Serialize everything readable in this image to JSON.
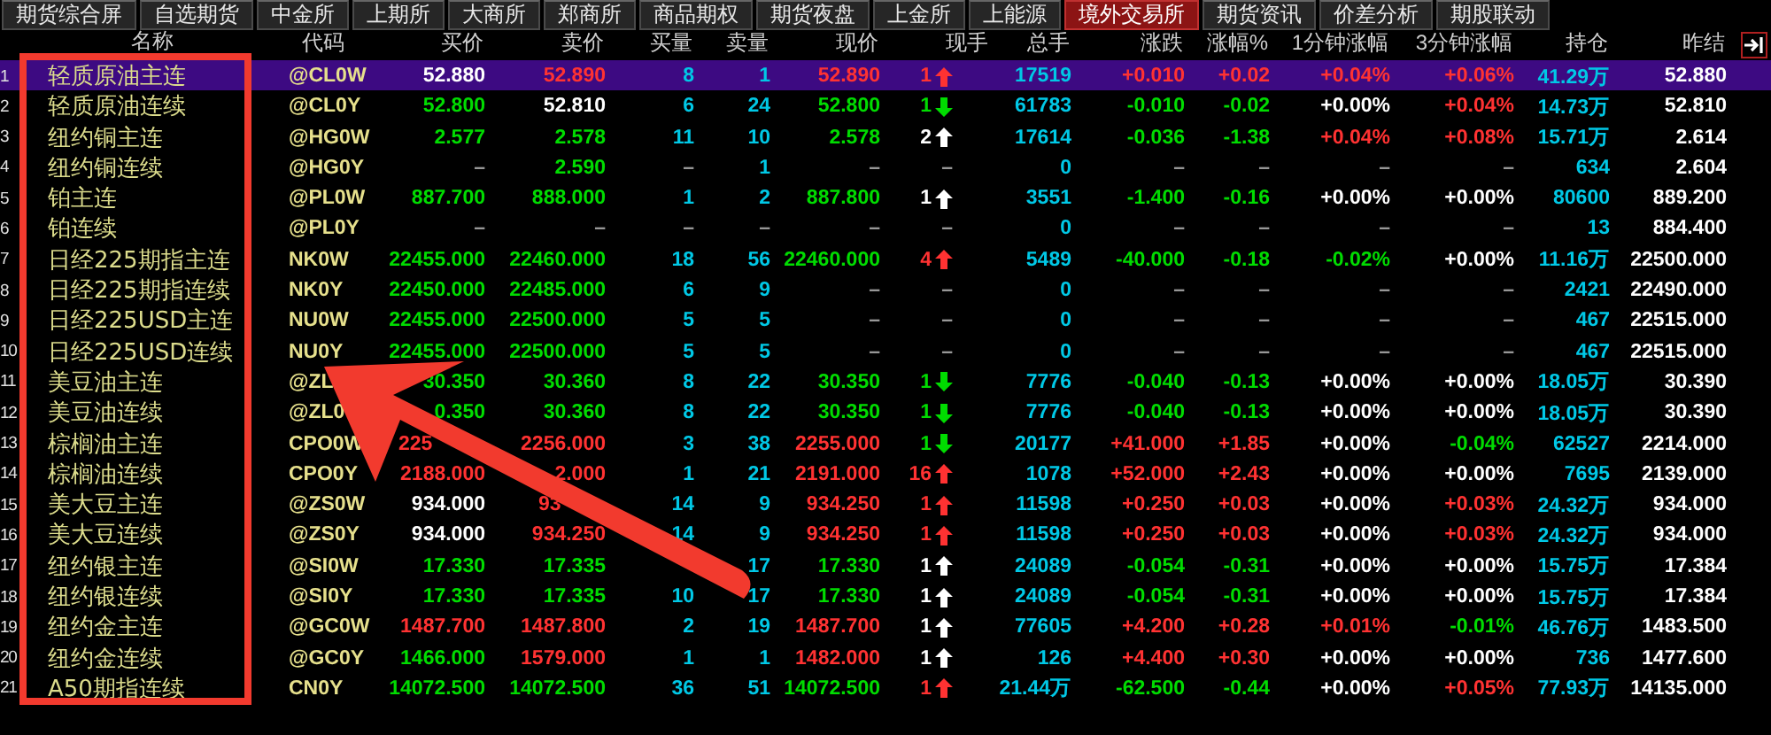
{
  "tabs": [
    {
      "label": "期货综合屏",
      "selected": false
    },
    {
      "label": "自选期货",
      "selected": false
    },
    {
      "label": "中金所",
      "selected": false
    },
    {
      "label": "上期所",
      "selected": false
    },
    {
      "label": "大商所",
      "selected": false
    },
    {
      "label": "郑商所",
      "selected": false
    },
    {
      "label": "商品期权",
      "selected": false
    },
    {
      "label": "期货夜盘",
      "selected": false
    },
    {
      "label": "上金所",
      "selected": false
    },
    {
      "label": "上能源",
      "selected": false
    },
    {
      "label": "境外交易所",
      "selected": true
    },
    {
      "label": "期货资讯",
      "selected": false
    },
    {
      "label": "价差分析",
      "selected": false
    },
    {
      "label": "期股联动",
      "selected": false
    }
  ],
  "columns": [
    "名称",
    "代码",
    "买价",
    "卖价",
    "买量",
    "卖量",
    "现价",
    "现手",
    "总手",
    "涨跌",
    "涨幅%",
    "1分钟涨幅",
    "3分钟涨幅",
    "持仓",
    "昨结"
  ],
  "rows": [
    {
      "no": "1",
      "name": "轻质原油主连",
      "code": "@CL0W",
      "selected": true,
      "cells": [
        {
          "text": "52.880",
          "kind": "even"
        },
        {
          "text": "52.890",
          "kind": "rise"
        },
        {
          "text": "8",
          "kind": "vol"
        },
        {
          "text": "1",
          "kind": "vol"
        },
        {
          "text": "52.890",
          "kind": "rise"
        },
        {
          "text": "1",
          "kind": "rise"
        },
        {
          "text": "17519",
          "kind": "vol"
        },
        {
          "text": "+0.010",
          "kind": "rise"
        },
        {
          "text": "+0.02",
          "kind": "rise"
        },
        {
          "text": "+0.04%",
          "kind": "rise"
        },
        {
          "text": "+0.06%",
          "kind": "rise"
        },
        {
          "text": "41.29万",
          "kind": "vol"
        },
        {
          "text": "52.880",
          "kind": "even"
        }
      ]
    },
    {
      "no": "2",
      "name": "轻质原油连续",
      "code": "@CL0Y",
      "selected": false,
      "cells": [
        {
          "text": "52.800",
          "kind": "fall"
        },
        {
          "text": "52.810",
          "kind": "even"
        },
        {
          "text": "6",
          "kind": "vol"
        },
        {
          "text": "24",
          "kind": "vol"
        },
        {
          "text": "52.800",
          "kind": "fall"
        },
        {
          "text": "1",
          "kind": "fall"
        },
        {
          "text": "61783",
          "kind": "vol"
        },
        {
          "text": "-0.010",
          "kind": "fall"
        },
        {
          "text": "-0.02",
          "kind": "fall"
        },
        {
          "text": "+0.00%",
          "kind": "even"
        },
        {
          "text": "+0.04%",
          "kind": "rise"
        },
        {
          "text": "14.73万",
          "kind": "vol"
        },
        {
          "text": "52.810",
          "kind": "even"
        }
      ]
    },
    {
      "no": "3",
      "name": "纽约铜主连",
      "code": "@HG0W",
      "selected": false,
      "cells": [
        {
          "text": "2.577",
          "kind": "fall"
        },
        {
          "text": "2.578",
          "kind": "fall"
        },
        {
          "text": "11",
          "kind": "vol"
        },
        {
          "text": "10",
          "kind": "vol"
        },
        {
          "text": "2.578",
          "kind": "fall"
        },
        {
          "text": "2",
          "kind": "even"
        },
        {
          "text": "17614",
          "kind": "vol"
        },
        {
          "text": "-0.036",
          "kind": "fall"
        },
        {
          "text": "-1.38",
          "kind": "fall"
        },
        {
          "text": "+0.04%",
          "kind": "rise"
        },
        {
          "text": "+0.08%",
          "kind": "rise"
        },
        {
          "text": "15.71万",
          "kind": "vol"
        },
        {
          "text": "2.614",
          "kind": "even"
        }
      ]
    },
    {
      "no": "4",
      "name": "纽约铜连续",
      "code": "@HG0Y",
      "selected": false,
      "cells": [
        {
          "text": "–",
          "kind": "dash"
        },
        {
          "text": "2.590",
          "kind": "fall"
        },
        {
          "text": "–",
          "kind": "dash"
        },
        {
          "text": "1",
          "kind": "vol"
        },
        {
          "text": "–",
          "kind": "dash"
        },
        {
          "text": "–",
          "kind": "dash"
        },
        {
          "text": "0",
          "kind": "vol"
        },
        {
          "text": "–",
          "kind": "dash"
        },
        {
          "text": "–",
          "kind": "dash"
        },
        {
          "text": "–",
          "kind": "dash"
        },
        {
          "text": "–",
          "kind": "dash"
        },
        {
          "text": "634",
          "kind": "vol"
        },
        {
          "text": "2.604",
          "kind": "even"
        }
      ]
    },
    {
      "no": "5",
      "name": "铂主连",
      "code": "@PL0W",
      "selected": false,
      "cells": [
        {
          "text": "887.700",
          "kind": "fall"
        },
        {
          "text": "888.000",
          "kind": "fall"
        },
        {
          "text": "1",
          "kind": "vol"
        },
        {
          "text": "2",
          "kind": "vol"
        },
        {
          "text": "887.800",
          "kind": "fall"
        },
        {
          "text": "1",
          "kind": "even"
        },
        {
          "text": "3551",
          "kind": "vol"
        },
        {
          "text": "-1.400",
          "kind": "fall"
        },
        {
          "text": "-0.16",
          "kind": "fall"
        },
        {
          "text": "+0.00%",
          "kind": "even"
        },
        {
          "text": "+0.00%",
          "kind": "even"
        },
        {
          "text": "80600",
          "kind": "vol"
        },
        {
          "text": "889.200",
          "kind": "even"
        }
      ]
    },
    {
      "no": "6",
      "name": "铂连续",
      "code": "@PL0Y",
      "selected": false,
      "cells": [
        {
          "text": "–",
          "kind": "dash"
        },
        {
          "text": "–",
          "kind": "dash"
        },
        {
          "text": "–",
          "kind": "dash"
        },
        {
          "text": "–",
          "kind": "dash"
        },
        {
          "text": "–",
          "kind": "dash"
        },
        {
          "text": "–",
          "kind": "dash"
        },
        {
          "text": "0",
          "kind": "vol"
        },
        {
          "text": "–",
          "kind": "dash"
        },
        {
          "text": "–",
          "kind": "dash"
        },
        {
          "text": "–",
          "kind": "dash"
        },
        {
          "text": "–",
          "kind": "dash"
        },
        {
          "text": "13",
          "kind": "vol"
        },
        {
          "text": "884.400",
          "kind": "even"
        }
      ]
    },
    {
      "no": "7",
      "name": "日经225期指主连",
      "code": "NK0W",
      "selected": false,
      "cells": [
        {
          "text": "22455.000",
          "kind": "fall"
        },
        {
          "text": "22460.000",
          "kind": "fall"
        },
        {
          "text": "18",
          "kind": "vol"
        },
        {
          "text": "56",
          "kind": "vol"
        },
        {
          "text": "22460.000",
          "kind": "fall"
        },
        {
          "text": "4",
          "kind": "rise"
        },
        {
          "text": "5489",
          "kind": "vol"
        },
        {
          "text": "-40.000",
          "kind": "fall"
        },
        {
          "text": "-0.18",
          "kind": "fall"
        },
        {
          "text": "-0.02%",
          "kind": "fall"
        },
        {
          "text": "+0.00%",
          "kind": "even"
        },
        {
          "text": "11.16万",
          "kind": "vol"
        },
        {
          "text": "22500.000",
          "kind": "even"
        }
      ]
    },
    {
      "no": "8",
      "name": "日经225期指连续",
      "code": "NK0Y",
      "selected": false,
      "cells": [
        {
          "text": "22450.000",
          "kind": "fall"
        },
        {
          "text": "22485.000",
          "kind": "fall"
        },
        {
          "text": "6",
          "kind": "vol"
        },
        {
          "text": "9",
          "kind": "vol"
        },
        {
          "text": "–",
          "kind": "dash"
        },
        {
          "text": "–",
          "kind": "dash"
        },
        {
          "text": "0",
          "kind": "vol"
        },
        {
          "text": "–",
          "kind": "dash"
        },
        {
          "text": "–",
          "kind": "dash"
        },
        {
          "text": "–",
          "kind": "dash"
        },
        {
          "text": "–",
          "kind": "dash"
        },
        {
          "text": "2421",
          "kind": "vol"
        },
        {
          "text": "22490.000",
          "kind": "even"
        }
      ]
    },
    {
      "no": "9",
      "name": "日经225USD主连",
      "code": "NU0W",
      "selected": false,
      "cells": [
        {
          "text": "22455.000",
          "kind": "fall"
        },
        {
          "text": "22500.000",
          "kind": "fall"
        },
        {
          "text": "5",
          "kind": "vol"
        },
        {
          "text": "5",
          "kind": "vol"
        },
        {
          "text": "–",
          "kind": "dash"
        },
        {
          "text": "–",
          "kind": "dash"
        },
        {
          "text": "0",
          "kind": "vol"
        },
        {
          "text": "–",
          "kind": "dash"
        },
        {
          "text": "–",
          "kind": "dash"
        },
        {
          "text": "–",
          "kind": "dash"
        },
        {
          "text": "–",
          "kind": "dash"
        },
        {
          "text": "467",
          "kind": "vol"
        },
        {
          "text": "22515.000",
          "kind": "even"
        }
      ]
    },
    {
      "no": "10",
      "name": "日经225USD连续",
      "code": "NU0Y",
      "selected": false,
      "cells": [
        {
          "text": "22455.000",
          "kind": "fall"
        },
        {
          "text": "22500.000",
          "kind": "fall"
        },
        {
          "text": "5",
          "kind": "vol"
        },
        {
          "text": "5",
          "kind": "vol"
        },
        {
          "text": "–",
          "kind": "dash"
        },
        {
          "text": "–",
          "kind": "dash"
        },
        {
          "text": "0",
          "kind": "vol"
        },
        {
          "text": "–",
          "kind": "dash"
        },
        {
          "text": "–",
          "kind": "dash"
        },
        {
          "text": "–",
          "kind": "dash"
        },
        {
          "text": "–",
          "kind": "dash"
        },
        {
          "text": "467",
          "kind": "vol"
        },
        {
          "text": "22515.000",
          "kind": "even"
        }
      ]
    },
    {
      "no": "11",
      "name": "美豆油主连",
      "code": "@ZL",
      "selected": false,
      "cells": [
        {
          "text": "30.350",
          "kind": "fall"
        },
        {
          "text": "30.360",
          "kind": "fall"
        },
        {
          "text": "8",
          "kind": "vol"
        },
        {
          "text": "22",
          "kind": "vol"
        },
        {
          "text": "30.350",
          "kind": "fall"
        },
        {
          "text": "1",
          "kind": "fall"
        },
        {
          "text": "7776",
          "kind": "vol"
        },
        {
          "text": "-0.040",
          "kind": "fall"
        },
        {
          "text": "-0.13",
          "kind": "fall"
        },
        {
          "text": "+0.00%",
          "kind": "even"
        },
        {
          "text": "+0.00%",
          "kind": "even"
        },
        {
          "text": "18.05万",
          "kind": "vol"
        },
        {
          "text": "30.390",
          "kind": "even"
        }
      ]
    },
    {
      "no": "12",
      "name": "美豆油连续",
      "code": "@ZL0",
      "selected": false,
      "cells": [
        {
          "text": "0.350",
          "kind": "fall"
        },
        {
          "text": "30.360",
          "kind": "fall"
        },
        {
          "text": "8",
          "kind": "vol"
        },
        {
          "text": "22",
          "kind": "vol"
        },
        {
          "text": "30.350",
          "kind": "fall"
        },
        {
          "text": "1",
          "kind": "fall"
        },
        {
          "text": "7776",
          "kind": "vol"
        },
        {
          "text": "-0.040",
          "kind": "fall"
        },
        {
          "text": "-0.13",
          "kind": "fall"
        },
        {
          "text": "+0.00%",
          "kind": "even"
        },
        {
          "text": "+0.00%",
          "kind": "even"
        },
        {
          "text": "18.05万",
          "kind": "vol"
        },
        {
          "text": "30.390",
          "kind": "even"
        }
      ]
    },
    {
      "no": "13",
      "name": "棕榈油主连",
      "code": "CPO0W",
      "selected": false,
      "cells": [
        {
          "text": "225",
          "kind": "rise_cut"
        },
        {
          "text": "2256.000",
          "kind": "rise"
        },
        {
          "text": "3",
          "kind": "vol"
        },
        {
          "text": "38",
          "kind": "vol"
        },
        {
          "text": "2255.000",
          "kind": "rise"
        },
        {
          "text": "1",
          "kind": "fall"
        },
        {
          "text": "20177",
          "kind": "vol"
        },
        {
          "text": "+41.000",
          "kind": "rise"
        },
        {
          "text": "+1.85",
          "kind": "rise"
        },
        {
          "text": "+0.00%",
          "kind": "even"
        },
        {
          "text": "-0.04%",
          "kind": "fall"
        },
        {
          "text": "62527",
          "kind": "vol"
        },
        {
          "text": "2214.000",
          "kind": "even"
        }
      ]
    },
    {
      "no": "14",
      "name": "棕榈油连续",
      "code": "CPO0Y",
      "selected": false,
      "cells": [
        {
          "text": "2188.000",
          "kind": "rise"
        },
        {
          "text": "2.000",
          "kind": "rise"
        },
        {
          "text": "1",
          "kind": "vol"
        },
        {
          "text": "21",
          "kind": "vol"
        },
        {
          "text": "2191.000",
          "kind": "rise"
        },
        {
          "text": "16",
          "kind": "rise"
        },
        {
          "text": "1078",
          "kind": "vol"
        },
        {
          "text": "+52.000",
          "kind": "rise"
        },
        {
          "text": "+2.43",
          "kind": "rise"
        },
        {
          "text": "+0.00%",
          "kind": "even"
        },
        {
          "text": "+0.00%",
          "kind": "even"
        },
        {
          "text": "7695",
          "kind": "vol"
        },
        {
          "text": "2139.000",
          "kind": "even"
        }
      ]
    },
    {
      "no": "15",
      "name": "美大豆主连",
      "code": "@ZS0W",
      "selected": false,
      "cells": [
        {
          "text": "934.000",
          "kind": "even"
        },
        {
          "text": "93",
          "kind": "rise_cut"
        },
        {
          "text": "14",
          "kind": "vol"
        },
        {
          "text": "9",
          "kind": "vol"
        },
        {
          "text": "934.250",
          "kind": "rise"
        },
        {
          "text": "1",
          "kind": "rise"
        },
        {
          "text": "11598",
          "kind": "vol"
        },
        {
          "text": "+0.250",
          "kind": "rise"
        },
        {
          "text": "+0.03",
          "kind": "rise"
        },
        {
          "text": "+0.00%",
          "kind": "even"
        },
        {
          "text": "+0.03%",
          "kind": "rise"
        },
        {
          "text": "24.32万",
          "kind": "vol"
        },
        {
          "text": "934.000",
          "kind": "even"
        }
      ]
    },
    {
      "no": "16",
      "name": "美大豆连续",
      "code": "@ZS0Y",
      "selected": false,
      "cells": [
        {
          "text": "934.000",
          "kind": "even"
        },
        {
          "text": "934.250",
          "kind": "rise"
        },
        {
          "text": "14",
          "kind": "vol"
        },
        {
          "text": "9",
          "kind": "vol"
        },
        {
          "text": "934.250",
          "kind": "rise"
        },
        {
          "text": "1",
          "kind": "rise"
        },
        {
          "text": "11598",
          "kind": "vol"
        },
        {
          "text": "+0.250",
          "kind": "rise"
        },
        {
          "text": "+0.03",
          "kind": "rise"
        },
        {
          "text": "+0.00%",
          "kind": "even"
        },
        {
          "text": "+0.03%",
          "kind": "rise"
        },
        {
          "text": "24.32万",
          "kind": "vol"
        },
        {
          "text": "934.000",
          "kind": "even"
        }
      ]
    },
    {
      "no": "17",
      "name": "纽约银主连",
      "code": "@SI0W",
      "selected": false,
      "cells": [
        {
          "text": "17.330",
          "kind": "fall"
        },
        {
          "text": "17.335",
          "kind": "fall"
        },
        {
          "kind": "covered"
        },
        {
          "text": "17",
          "kind": "vol"
        },
        {
          "text": "17.330",
          "kind": "fall"
        },
        {
          "text": "1",
          "kind": "even"
        },
        {
          "text": "24089",
          "kind": "vol"
        },
        {
          "text": "-0.054",
          "kind": "fall"
        },
        {
          "text": "-0.31",
          "kind": "fall"
        },
        {
          "text": "+0.00%",
          "kind": "even"
        },
        {
          "text": "+0.00%",
          "kind": "even"
        },
        {
          "text": "15.75万",
          "kind": "vol"
        },
        {
          "text": "17.384",
          "kind": "even"
        }
      ]
    },
    {
      "no": "18",
      "name": "纽约银连续",
      "code": "@SI0Y",
      "selected": false,
      "cells": [
        {
          "text": "17.330",
          "kind": "fall"
        },
        {
          "text": "17.335",
          "kind": "fall"
        },
        {
          "text": "10",
          "kind": "vol"
        },
        {
          "text": "17",
          "kind": "vol"
        },
        {
          "text": "17.330",
          "kind": "fall"
        },
        {
          "text": "1",
          "kind": "even"
        },
        {
          "text": "24089",
          "kind": "vol"
        },
        {
          "text": "-0.054",
          "kind": "fall"
        },
        {
          "text": "-0.31",
          "kind": "fall"
        },
        {
          "text": "+0.00%",
          "kind": "even"
        },
        {
          "text": "+0.00%",
          "kind": "even"
        },
        {
          "text": "15.75万",
          "kind": "vol"
        },
        {
          "text": "17.384",
          "kind": "even"
        }
      ]
    },
    {
      "no": "19",
      "name": "纽约金主连",
      "code": "@GC0W",
      "selected": false,
      "cells": [
        {
          "text": "1487.700",
          "kind": "rise"
        },
        {
          "text": "1487.800",
          "kind": "rise"
        },
        {
          "text": "2",
          "kind": "vol"
        },
        {
          "text": "19",
          "kind": "vol"
        },
        {
          "text": "1487.700",
          "kind": "rise"
        },
        {
          "text": "1",
          "kind": "even"
        },
        {
          "text": "77605",
          "kind": "vol"
        },
        {
          "text": "+4.200",
          "kind": "rise"
        },
        {
          "text": "+0.28",
          "kind": "rise"
        },
        {
          "text": "+0.01%",
          "kind": "rise"
        },
        {
          "text": "-0.01%",
          "kind": "fall"
        },
        {
          "text": "46.76万",
          "kind": "vol"
        },
        {
          "text": "1483.500",
          "kind": "even"
        }
      ]
    },
    {
      "no": "20",
      "name": "纽约金连续",
      "code": "@GC0Y",
      "selected": false,
      "cells": [
        {
          "text": "1466.000",
          "kind": "fall"
        },
        {
          "text": "1579.000",
          "kind": "rise"
        },
        {
          "text": "1",
          "kind": "vol"
        },
        {
          "text": "1",
          "kind": "vol"
        },
        {
          "text": "1482.000",
          "kind": "rise"
        },
        {
          "text": "1",
          "kind": "even"
        },
        {
          "text": "126",
          "kind": "vol"
        },
        {
          "text": "+4.400",
          "kind": "rise"
        },
        {
          "text": "+0.30",
          "kind": "rise"
        },
        {
          "text": "+0.00%",
          "kind": "even"
        },
        {
          "text": "+0.00%",
          "kind": "even"
        },
        {
          "text": "736",
          "kind": "vol"
        },
        {
          "text": "1477.600",
          "kind": "even"
        }
      ]
    },
    {
      "no": "21",
      "name": "A50期指连续",
      "code": "CN0Y",
      "selected": false,
      "cells": [
        {
          "text": "14072.500",
          "kind": "fall"
        },
        {
          "text": "14072.500",
          "kind": "fall"
        },
        {
          "text": "36",
          "kind": "vol"
        },
        {
          "text": "51",
          "kind": "vol"
        },
        {
          "text": "14072.500",
          "kind": "fall"
        },
        {
          "text": "1",
          "kind": "rise"
        },
        {
          "text": "21.44万",
          "kind": "vol"
        },
        {
          "text": "-62.500",
          "kind": "fall"
        },
        {
          "text": "-0.44",
          "kind": "fall"
        },
        {
          "text": "+0.00%",
          "kind": "even"
        },
        {
          "text": "+0.05%",
          "kind": "rise"
        },
        {
          "text": "77.93万",
          "kind": "vol"
        },
        {
          "text": "14135.000",
          "kind": "even"
        }
      ]
    }
  ]
}
